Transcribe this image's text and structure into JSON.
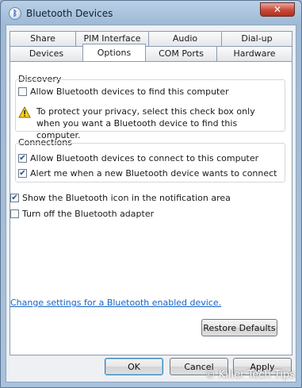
{
  "window": {
    "title": "Bluetooth Devices",
    "close_glyph": "✕"
  },
  "tabs": {
    "row1": [
      "Share",
      "PIM Interface",
      "Audio",
      "Dial-up"
    ],
    "row2": [
      "Devices",
      "Options",
      "COM Ports",
      "Hardware"
    ],
    "active": "Options"
  },
  "discovery": {
    "label": "Discovery",
    "allow_find": {
      "label": "Allow Bluetooth devices to find this computer",
      "checked": false
    },
    "warning": "To protect your privacy, select this check box only when you want a Bluetooth device to find this computer."
  },
  "connections": {
    "label": "Connections",
    "allow_connect": {
      "label": "Allow Bluetooth devices to connect to this computer",
      "checked": true
    },
    "alert_new": {
      "label": "Alert me when a new Bluetooth device wants to connect",
      "checked": true
    }
  },
  "show_icon": {
    "label": "Show the Bluetooth icon in the notification area",
    "checked": true
  },
  "turn_off": {
    "label": "Turn off the Bluetooth adapter",
    "checked": false
  },
  "change_settings_link": "Change settings for a Bluetooth enabled device.",
  "buttons": {
    "restore": "Restore Defaults",
    "ok": "OK",
    "cancel": "Cancel",
    "apply": "Apply"
  },
  "watermark": "© Killer Tech Tips",
  "checkmark": "✔"
}
